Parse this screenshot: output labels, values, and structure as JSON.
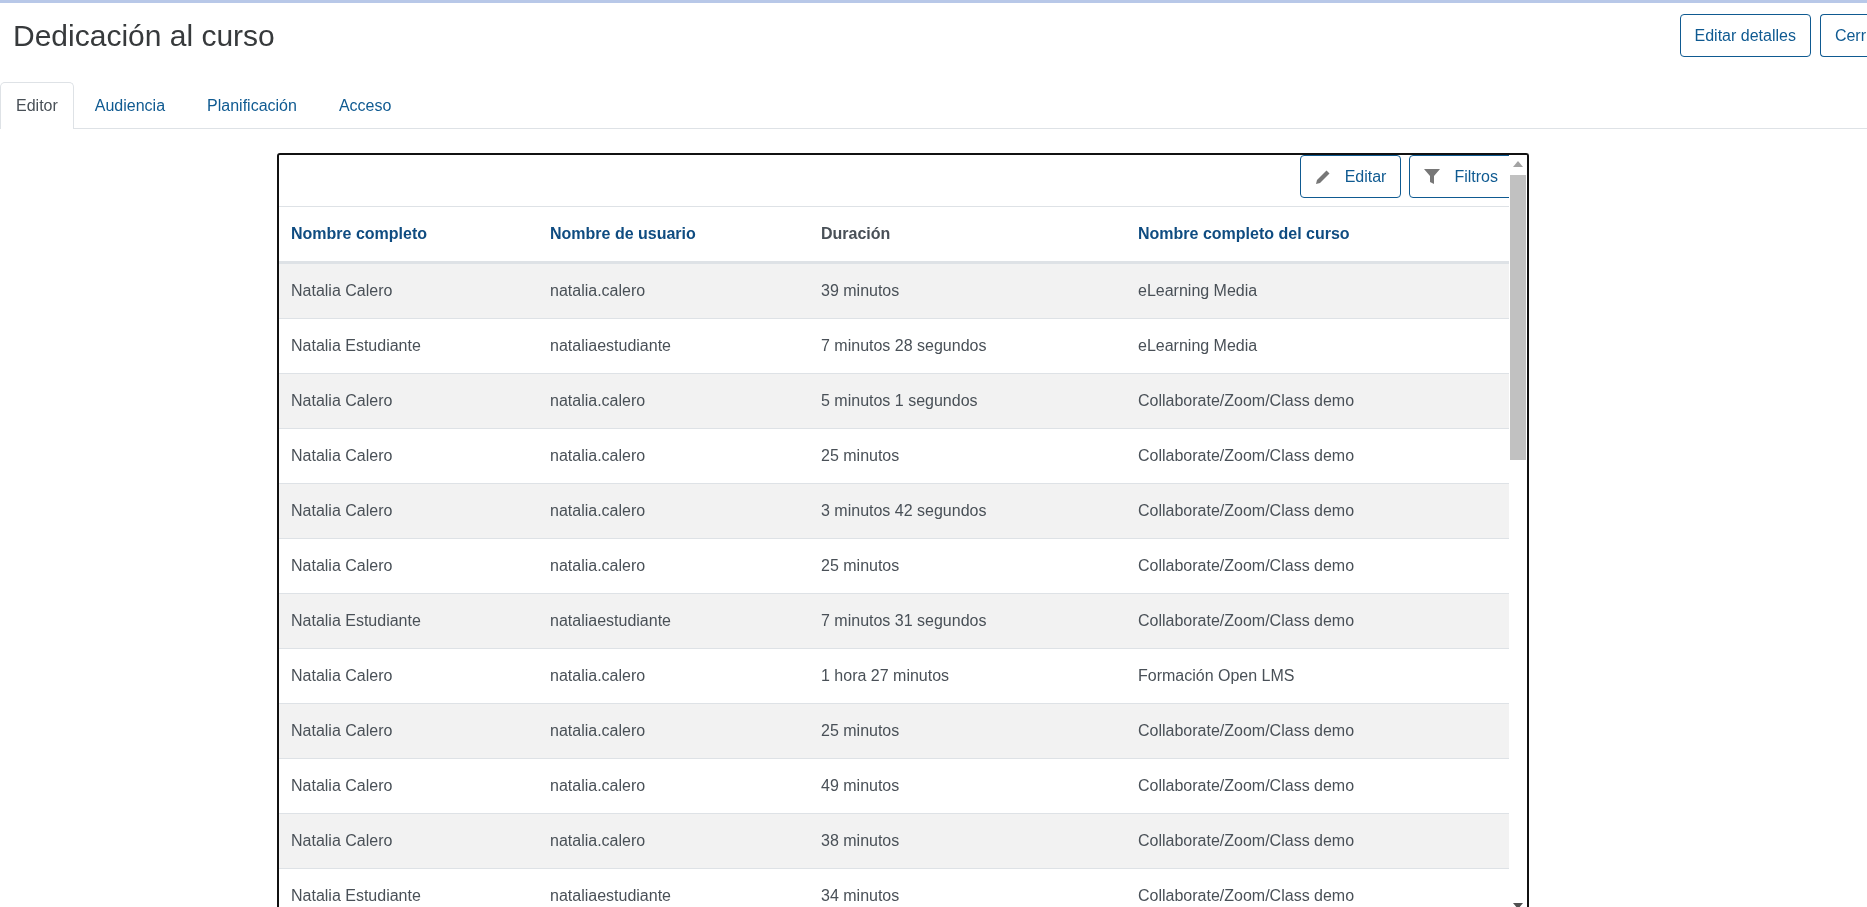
{
  "page": {
    "title": "Dedicación al curso",
    "actions": [
      {
        "label": "Editar detalles"
      },
      {
        "label": "Cerr"
      }
    ]
  },
  "tabs": [
    {
      "label": "Editor",
      "selected": true
    },
    {
      "label": "Audiencia",
      "selected": false
    },
    {
      "label": "Planificación",
      "selected": false
    },
    {
      "label": "Acceso",
      "selected": false
    }
  ],
  "toolbar": [
    {
      "label": "Editar",
      "kind": "edit"
    },
    {
      "label": "Filtros",
      "kind": "filter"
    }
  ],
  "table": {
    "columns": [
      {
        "label": "Nombre completo",
        "sortable": true
      },
      {
        "label": "Nombre de usuario",
        "sortable": true
      },
      {
        "label": "Duración",
        "sortable": false
      },
      {
        "label": "Nombre completo del curso",
        "sortable": true
      }
    ],
    "rows": [
      [
        "Natalia Calero",
        "natalia.calero",
        "39 minutos",
        "eLearning Media"
      ],
      [
        "Natalia Estudiante",
        "nataliaestudiante",
        "7 minutos 28 segundos",
        "eLearning Media"
      ],
      [
        "Natalia Calero",
        "natalia.calero",
        "5 minutos 1 segundos",
        "Collaborate/Zoom/Class demo"
      ],
      [
        "Natalia Calero",
        "natalia.calero",
        "25 minutos",
        "Collaborate/Zoom/Class demo"
      ],
      [
        "Natalia Calero",
        "natalia.calero",
        "3 minutos 42 segundos",
        "Collaborate/Zoom/Class demo"
      ],
      [
        "Natalia Calero",
        "natalia.calero",
        "25 minutos",
        "Collaborate/Zoom/Class demo"
      ],
      [
        "Natalia Estudiante",
        "nataliaestudiante",
        "7 minutos 31 segundos",
        "Collaborate/Zoom/Class demo"
      ],
      [
        "Natalia Calero",
        "natalia.calero",
        "1 hora 27 minutos",
        "Formación Open LMS"
      ],
      [
        "Natalia Calero",
        "natalia.calero",
        "25 minutos",
        "Collaborate/Zoom/Class demo"
      ],
      [
        "Natalia Calero",
        "natalia.calero",
        "49 minutos",
        "Collaborate/Zoom/Class demo"
      ],
      [
        "Natalia Calero",
        "natalia.calero",
        "38 minutos",
        "Collaborate/Zoom/Class demo"
      ],
      [
        "Natalia Estudiante",
        "nataliaestudiante",
        "34 minutos",
        "Collaborate/Zoom/Class demo"
      ]
    ]
  }
}
